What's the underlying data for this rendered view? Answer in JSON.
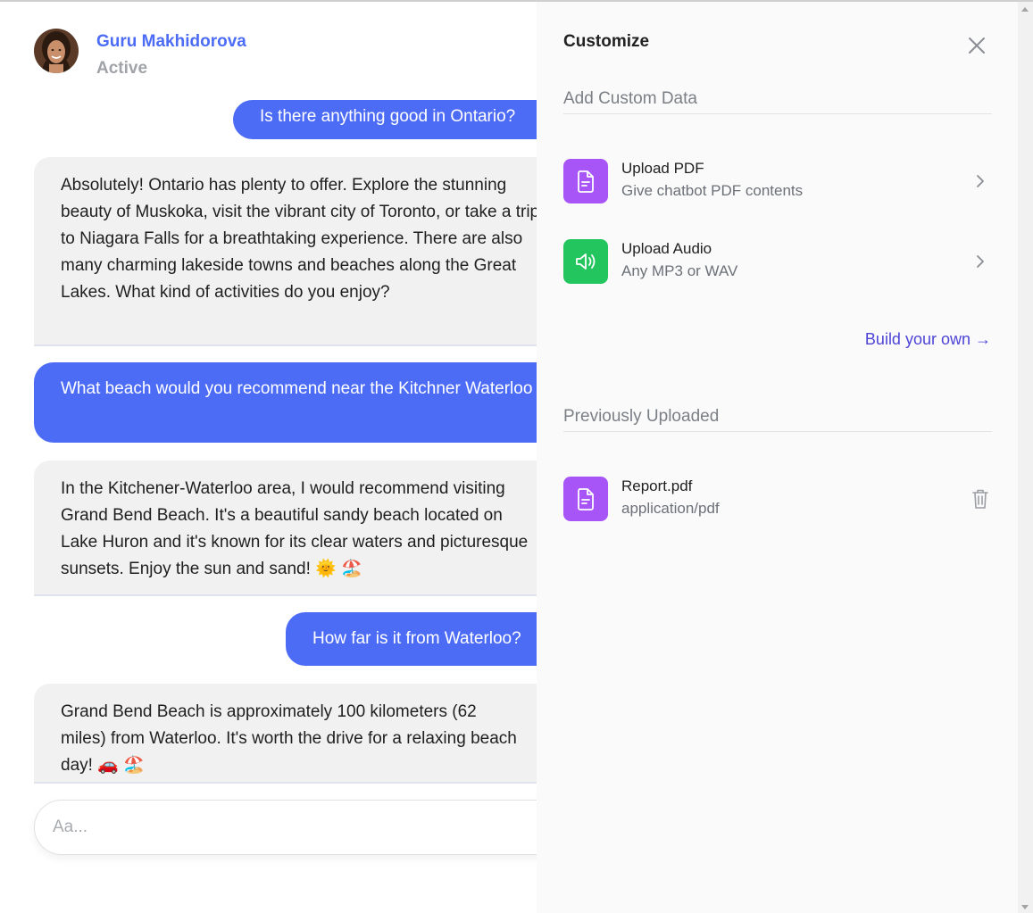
{
  "colors": {
    "accent": "#4d6cf5",
    "pdf_tile": "#a855f7",
    "audio_tile": "#22c55e",
    "link": "#4d44d6"
  },
  "header": {
    "name": "Guru Makhidorova",
    "status": "Active"
  },
  "messages": [
    {
      "role": "user",
      "text": "Is there anything good in Ontario?"
    },
    {
      "role": "bot",
      "text": "Absolutely! Ontario has plenty to offer. Explore the stunning beauty of Muskoka, visit the vibrant city of Toronto, or take a trip to Niagara Falls for a breathtaking experience. There are also many charming lakeside towns and beaches along the Great Lakes. What kind of activities do you enjoy?"
    },
    {
      "role": "user",
      "text": "What beach would you recommend near the Kitchner Waterloo area?"
    },
    {
      "role": "bot",
      "text": "In the Kitchener-Waterloo area, I would recommend visiting Grand Bend Beach. It's a beautiful sandy beach located on Lake Huron and it's known for its clear waters and picturesque sunsets. Enjoy the sun and sand! 🌞 🏖️"
    },
    {
      "role": "user",
      "text": "How far is it from Waterloo?"
    },
    {
      "role": "bot",
      "text": "Grand Bend Beach is approximately 100 kilometers (62 miles) from Waterloo. It's worth the drive for a relaxing beach day! 🚗 🏖️"
    }
  ],
  "composer": {
    "placeholder": "Aa..."
  },
  "panel": {
    "title": "Customize",
    "add_section": "Add Custom Data",
    "options": [
      {
        "title": "Upload PDF",
        "subtitle": "Give chatbot PDF contents",
        "icon": "file-icon"
      },
      {
        "title": "Upload Audio",
        "subtitle": "Any MP3 or WAV",
        "icon": "speaker-icon"
      }
    ],
    "build_link": "Build your own →",
    "previous_section": "Previously Uploaded",
    "uploads": [
      {
        "name": "Report.pdf",
        "type": "application/pdf",
        "icon": "file-icon"
      }
    ]
  }
}
